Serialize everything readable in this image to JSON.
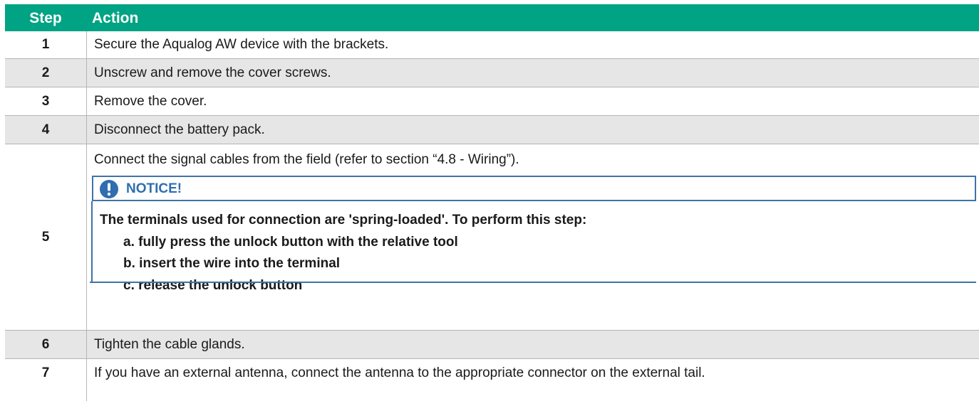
{
  "table": {
    "header": {
      "step": "Step",
      "action": "Action"
    },
    "rows": [
      {
        "step": "1",
        "action": "Secure the Aqualog AW device with the brackets."
      },
      {
        "step": "2",
        "action": "Unscrew and remove the cover screws."
      },
      {
        "step": "3",
        "action": "Remove the cover."
      },
      {
        "step": "4",
        "action": "Disconnect the battery pack."
      },
      {
        "step": "5",
        "action": "Connect the signal cables from the field (refer to section “4.8  - Wiring”).",
        "notice": {
          "title": "NOTICE!",
          "lead": "The terminals used for connection are 'spring-loaded'. To perform this step:",
          "items": [
            "a. fully press the unlock button with the relative tool",
            "b. insert the wire into the terminal",
            "c. release the unlock button"
          ]
        }
      },
      {
        "step": "6",
        "action": "Tighten the cable glands."
      },
      {
        "step": "7",
        "action": "If you have an external antenna, connect the antenna to the appropriate connector on the external tail."
      }
    ]
  },
  "colors": {
    "header_bg": "#00a383",
    "row_shade": "#e6e6e6",
    "notice_accent": "#2f6eb0",
    "grid": "#b5b5b5"
  },
  "icons": {
    "notice": "exclamation-circle-icon"
  }
}
